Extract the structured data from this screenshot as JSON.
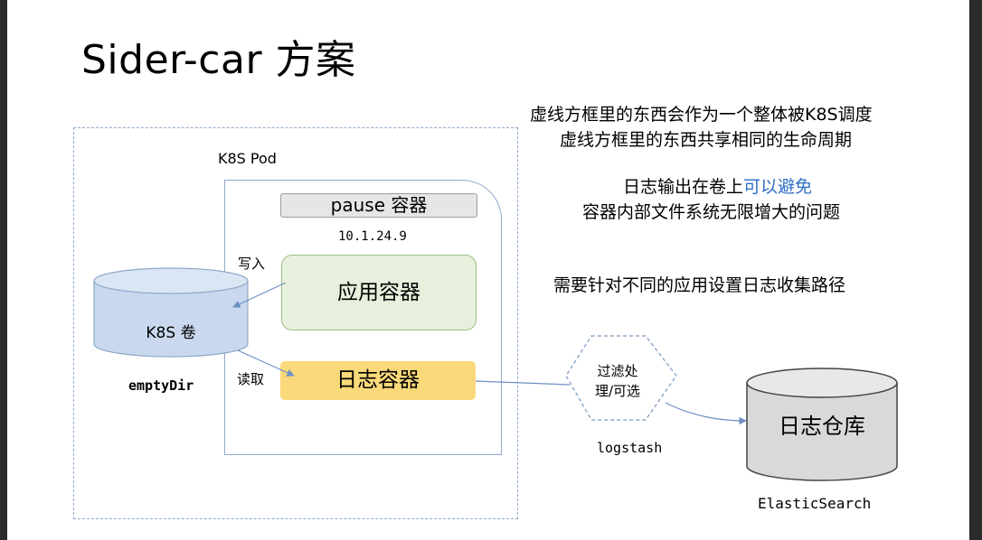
{
  "title": "Sider-car 方案",
  "notes": {
    "line1": "虚线方框里的东西会作为一个整体被K8S调度",
    "line2": "虚线方框里的东西共享相同的生命周期",
    "line3_black": "日志输出在卷上",
    "line3_blue": "可以避免",
    "line4_blue": "容器内部文件系统无限增大的问题",
    "line5": "需要针对不同的应用设置日志收集路径"
  },
  "pod": {
    "label": "K8S Pod",
    "pause": "pause 容器",
    "ip": "10.1.24.9",
    "app": "应用容器",
    "log": "日志容器"
  },
  "volume": {
    "label": "K8S 卷",
    "type": "emptyDir",
    "write": "写入",
    "read": "读取"
  },
  "logstash": {
    "line1": "过滤处",
    "line2": "理/可选",
    "label": "logstash"
  },
  "warehouse": {
    "label": "日志仓库",
    "caption": "ElasticSearch"
  },
  "colors": {
    "volume_fill": "#c9d8ee",
    "app_fill": "#e6f0dc",
    "log_fill": "#fad97a",
    "pause_fill": "#e6e6e6",
    "warehouse_fill": "#d9d9d9",
    "dashed_border": "#8fa9c9",
    "highlight_text": "#2e6fc6"
  }
}
